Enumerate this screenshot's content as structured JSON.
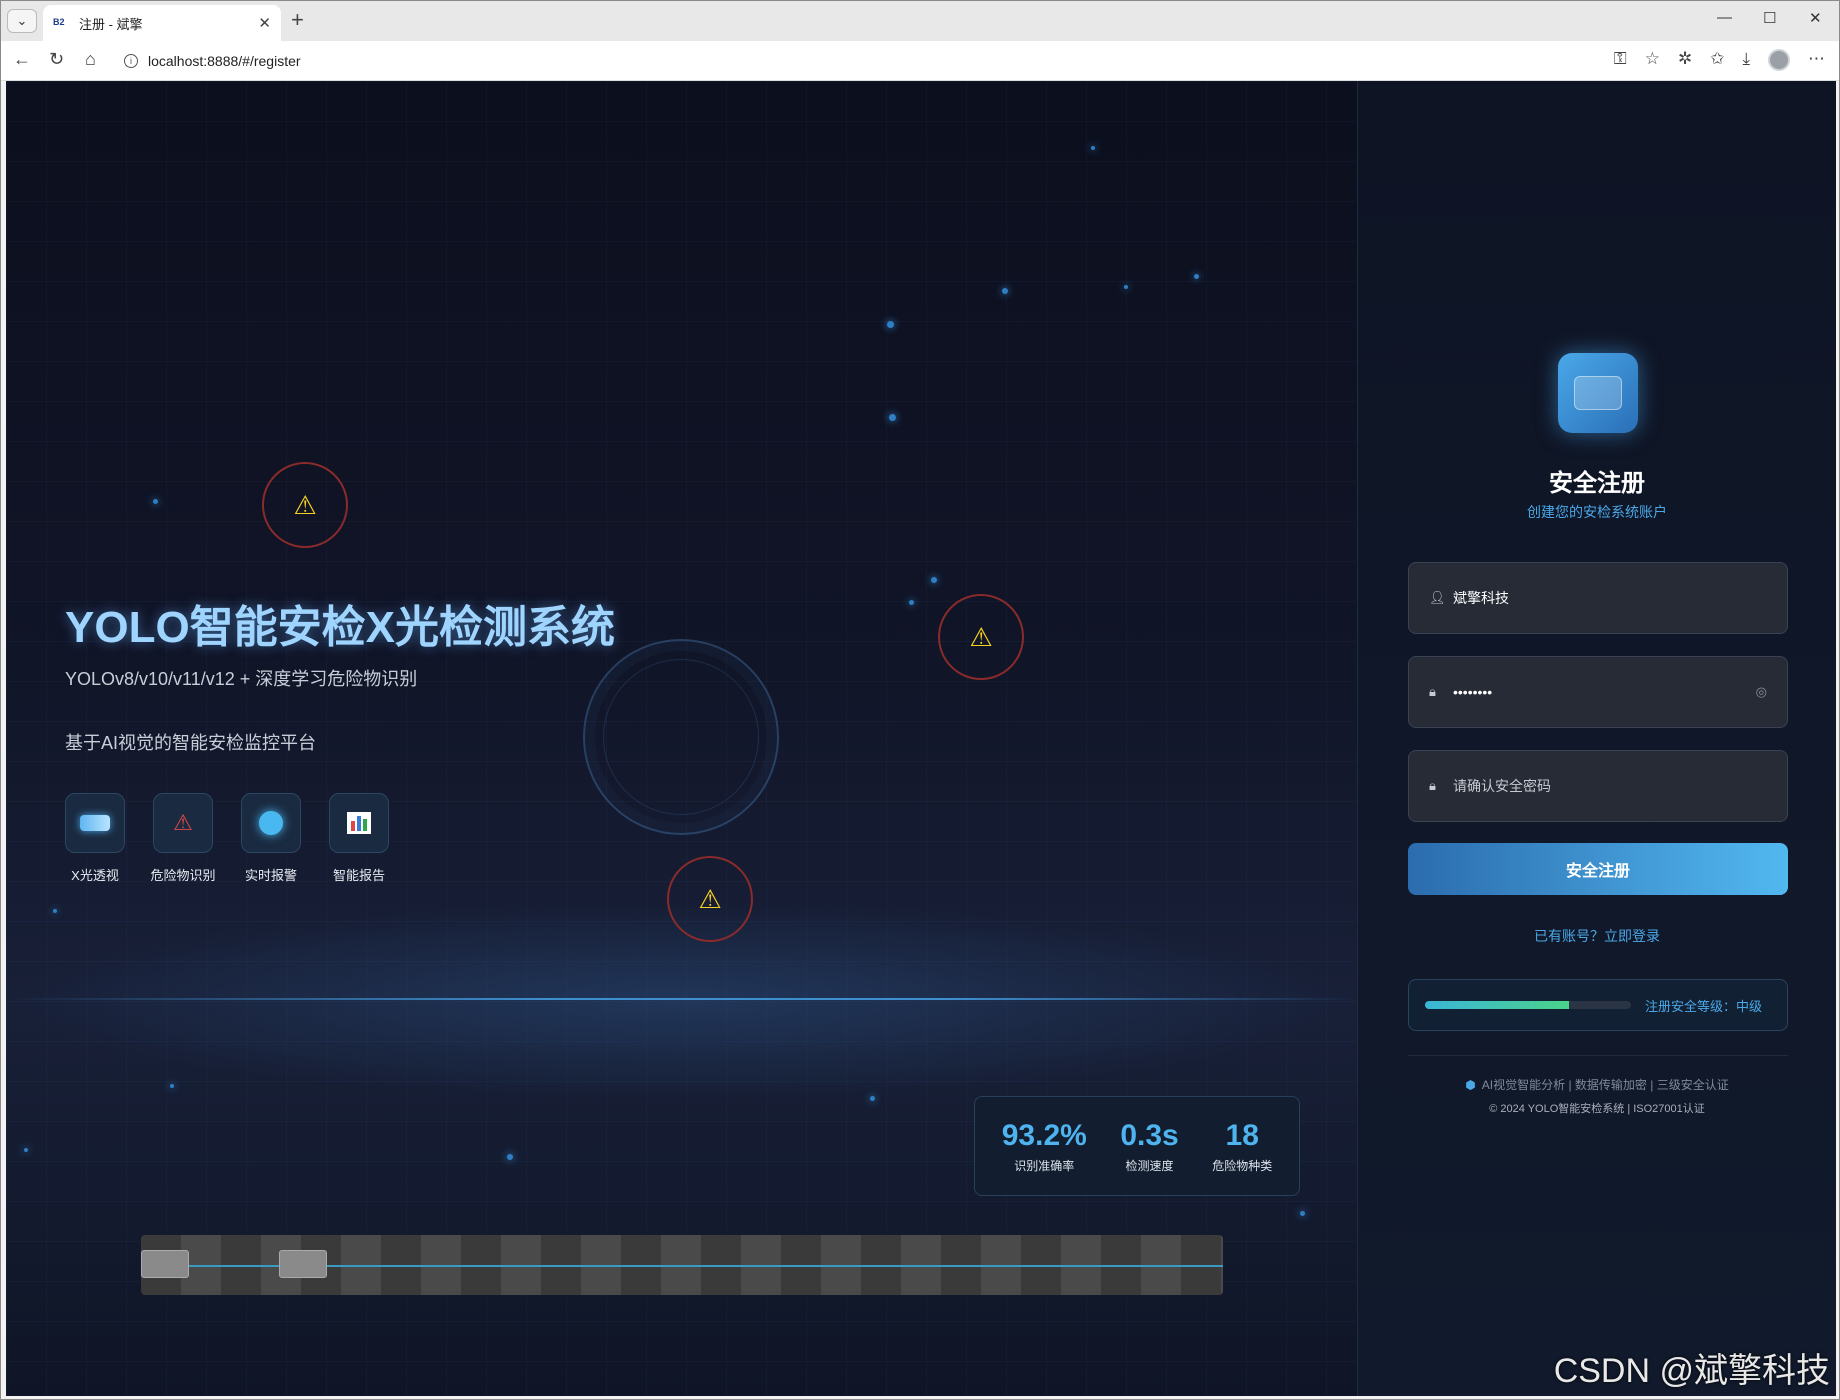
{
  "browser": {
    "tab_title": "注册 - 斌擎",
    "tab_favicon": "B2",
    "url": "localhost:8888/#/register"
  },
  "hero": {
    "title": "YOLO智能安检X光检测系统",
    "subtitle": "YOLOv8/v10/v11/v12 + 深度学习危险物识别",
    "description": "基于AI视觉的智能安检监控平台",
    "features": [
      {
        "label": "X光透视",
        "icon": "xray-icon"
      },
      {
        "label": "危险物识别",
        "icon": "warning-icon"
      },
      {
        "label": "实时报警",
        "icon": "alarm-dot-icon"
      },
      {
        "label": "智能报告",
        "icon": "bar-chart-icon"
      }
    ]
  },
  "stats": [
    {
      "value": "93.2%",
      "label": "识别准确率"
    },
    {
      "value": "0.3s",
      "label": "检测速度"
    },
    {
      "value": "18",
      "label": "危险物种类"
    }
  ],
  "register": {
    "title": "安全注册",
    "subtitle": "创建您的安检系统账户",
    "username_value": "斌擎科技",
    "password_value": "••••••••",
    "confirm_placeholder": "请确认安全密码",
    "submit_label": "安全注册",
    "login_link": "已有账号？立即登录",
    "security_level_text": "注册安全等级：中级",
    "security_level": 0.7,
    "footer_line1": "AI视觉智能分析 | 数据传输加密 | 三级安全认证",
    "footer_line2": "© 2024 YOLO智能安检系统 | ISO27001认证"
  },
  "watermark": "CSDN @斌擎科技",
  "colors": {
    "accent": "#4aa8e8",
    "hazard_ring": "#8a2b2b",
    "hazard_icon": "#f5d020"
  }
}
